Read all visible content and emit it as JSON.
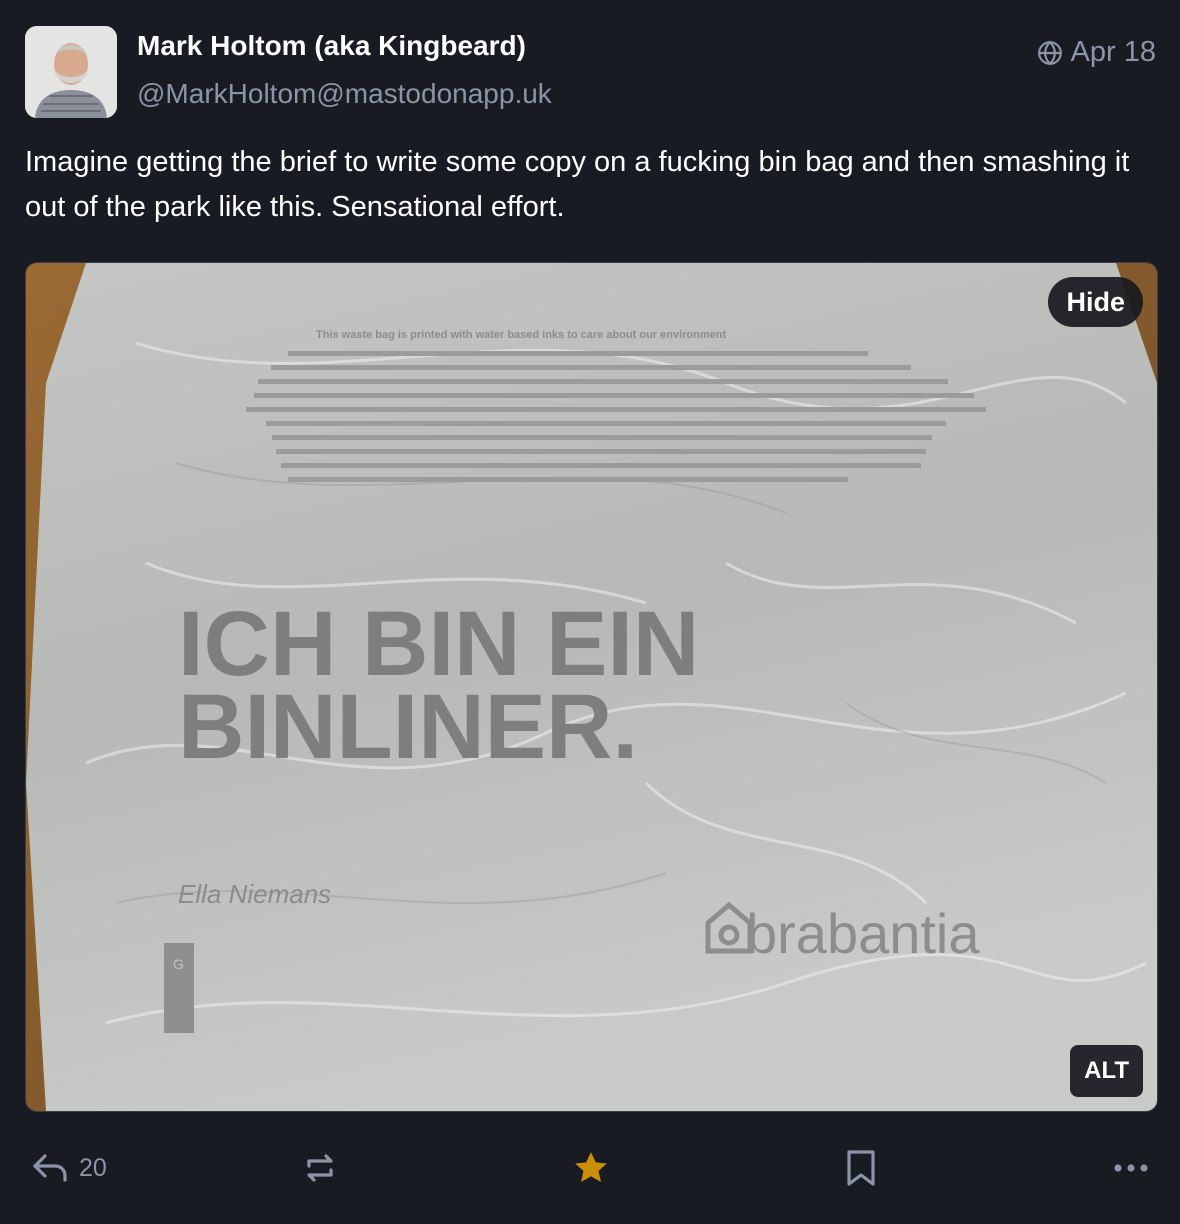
{
  "post": {
    "author_name": "Mark Holtom (aka Kingbeard)",
    "author_handle": "@MarkHoltom@mastodonapp.uk",
    "date": "Apr 18",
    "visibility_icon": "globe-icon",
    "text": "Imagine getting the brief to write some copy on a fucking bin bag and then smashing it out of the park like this. Sensational effort."
  },
  "media": {
    "hide_label": "Hide",
    "alt_label": "ALT",
    "bag_print": {
      "headline_line1": "ICH BIN EIN",
      "headline_line2": "BINLINER.",
      "signature": "Ella Niemans",
      "brand": "brabantia",
      "size_code": "G",
      "warning_line": "This waste bag is printed with water based inks to care about our environment"
    }
  },
  "actions": {
    "reply_icon": "reply-icon",
    "reply_count": "20",
    "boost_icon": "boost-icon",
    "favourite_icon": "star-icon",
    "favourite_color": "#ca8f04",
    "bookmark_icon": "bookmark-icon",
    "more_icon": "more-icon"
  }
}
